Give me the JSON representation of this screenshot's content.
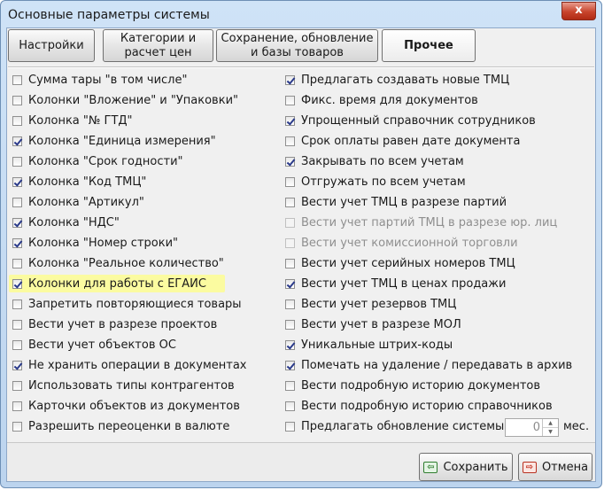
{
  "window": {
    "title": "Основные параметры системы",
    "close_label": "x"
  },
  "tabs": [
    {
      "label": "Настройки",
      "active": false
    },
    {
      "label": "Категории и\nрасчет цен",
      "active": false
    },
    {
      "label": "Сохранение, обновление\nи базы товаров",
      "active": false
    },
    {
      "label": "Прочее",
      "active": true
    }
  ],
  "left_options": [
    {
      "label": "Сумма тары \"в том числе\"",
      "checked": false
    },
    {
      "label": "Колонки \"Вложение\" и \"Упаковки\"",
      "checked": false
    },
    {
      "label": "Колонка \"№ ГТД\"",
      "checked": false
    },
    {
      "label": "Колонка \"Единица измерения\"",
      "checked": true
    },
    {
      "label": "Колонка \"Срок годности\"",
      "checked": false
    },
    {
      "label": "Колонка \"Код ТМЦ\"",
      "checked": true
    },
    {
      "label": "Колонка \"Артикул\"",
      "checked": false
    },
    {
      "label": "Колонка \"НДС\"",
      "checked": true
    },
    {
      "label": "Колонка \"Номер строки\"",
      "checked": true
    },
    {
      "label": "Колонка \"Реальное количество\"",
      "checked": false
    },
    {
      "label": "Колонки для работы с ЕГАИС",
      "checked": true,
      "highlighted": true
    },
    {
      "label": "Запретить повторяющиеся товары",
      "checked": false
    },
    {
      "label": "Вести учет в разрезе  проектов",
      "checked": false
    },
    {
      "label": "Вести учет объектов ОС",
      "checked": false
    },
    {
      "label": "Не хранить операции в документах",
      "checked": true
    },
    {
      "label": "Использовать типы контрагентов",
      "checked": false
    },
    {
      "label": "Карточки объектов из документов",
      "checked": false
    },
    {
      "label": "Разрешить переоценки в валюте",
      "checked": false
    }
  ],
  "right_options": [
    {
      "label": "Предлагать создавать новые ТМЦ",
      "checked": true
    },
    {
      "label": "Фикс. время для документов",
      "checked": false
    },
    {
      "label": "Упрощенный справочник сотрудников",
      "checked": true
    },
    {
      "label": "Срок оплаты равен дате документа",
      "checked": false
    },
    {
      "label": "Закрывать по всем учетам",
      "checked": true
    },
    {
      "label": "Отгружать по всем учетам",
      "checked": false
    },
    {
      "label": "Вести учет ТМЦ в разрезе партий",
      "checked": false
    },
    {
      "label": "Вести учет партий ТМЦ в разрезе юр. лиц",
      "checked": false,
      "disabled": true
    },
    {
      "label": "Вести учет комиссионной торговли",
      "checked": false,
      "disabled": true
    },
    {
      "label": "Вести учет серийных номеров ТМЦ",
      "checked": false
    },
    {
      "label": "Вести учет ТМЦ в ценах продажи",
      "checked": true
    },
    {
      "label": "Вести учет резервов ТМЦ",
      "checked": false
    },
    {
      "label": "Вести учет в разрезе МОЛ",
      "checked": false
    },
    {
      "label": "Уникальные штрих-коды",
      "checked": true
    },
    {
      "label": "Помечать на удаление / передавать в архив",
      "checked": true
    },
    {
      "label": "Вести подробную историю документов",
      "checked": false
    },
    {
      "label": "Вести подробную историю справочников",
      "checked": false
    },
    {
      "label": "Предлагать обновление системы",
      "checked": false
    }
  ],
  "update_months": {
    "value": "0",
    "unit": "мес."
  },
  "footer": {
    "save_label": "Сохранить",
    "cancel_label": "Отмена",
    "save_icon": "save-icon",
    "cancel_icon": "cancel-icon"
  },
  "colors": {
    "highlight": "#fbfba0",
    "title_bar": "#c9ddf2",
    "close_button": "#c8442c"
  }
}
